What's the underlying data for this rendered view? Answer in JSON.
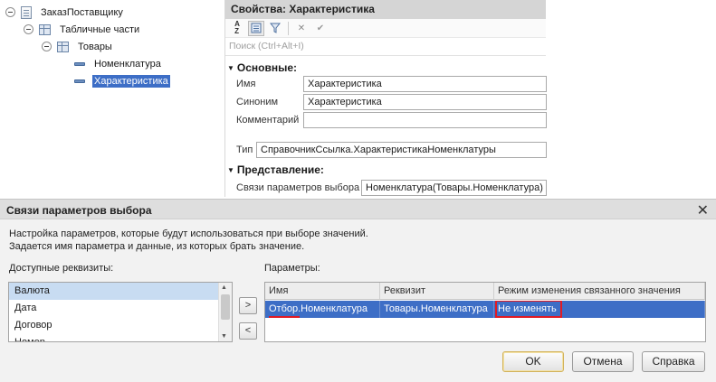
{
  "tree": {
    "items": [
      {
        "label": "ЗаказПоставщику"
      },
      {
        "label": "Табличные части"
      },
      {
        "label": "Товары"
      },
      {
        "label": "Номенклатура"
      },
      {
        "label": "Характеристика"
      }
    ]
  },
  "props": {
    "title": "Свойства: Характеристика",
    "toolbar": {
      "sort": "A↓Z",
      "check": "✔",
      "close": "✕"
    },
    "search_placeholder": "Поиск (Ctrl+Alt+I)",
    "section_main": "Основные:",
    "name_label": "Имя",
    "name_value": "Характеристика",
    "synonym_label": "Синоним",
    "synonym_value": "Характеристика",
    "comment_label": "Комментарий",
    "comment_value": "",
    "type_label": "Тип",
    "type_value": "СправочникСсылка.ХарактеристикаНоменклатуры",
    "section_view": "Представление:",
    "links_label": "Связи параметров выбора",
    "links_value": "Номенклатура(Товары.Номенклатура)"
  },
  "dialog": {
    "title": "Связи параметров выбора",
    "close": "✕",
    "desc_line1": "Настройка параметров, которые будут использоваться при выборе значений.",
    "desc_line2": "Задается имя параметра и данные, из которых брать значение.",
    "available_label": "Доступные реквизиты:",
    "available_items": [
      "Валюта",
      "Дата",
      "Договор",
      "Номер"
    ],
    "add_button": ">",
    "remove_button": "<",
    "params_label": "Параметры:",
    "grid": {
      "headers": [
        "Имя",
        "Реквизит",
        "Режим изменения связанного значения"
      ],
      "rows": [
        [
          "Отбор.Номенклатура",
          "Товары.Номенклатура",
          "Не изменять"
        ]
      ]
    },
    "ok": "OK",
    "cancel": "Отмена",
    "help": "Справка"
  }
}
